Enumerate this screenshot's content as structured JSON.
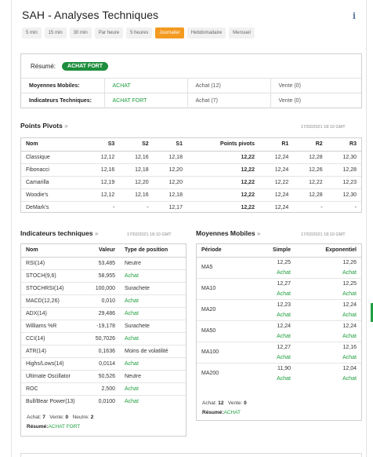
{
  "header": {
    "title": "SAH - Analyses Techniques",
    "info_icon": "info-icon"
  },
  "timeframes": [
    "5 min",
    "15 min",
    "30 min",
    "Par heure",
    "5 heures",
    "Journalier",
    "Hebdomadaire",
    "Mensuel"
  ],
  "active_timeframe": "Journalier",
  "summary": {
    "label": "Résumé:",
    "verdict": "ACHAT FORT",
    "rows": [
      {
        "name": "Moyennes Mobiles:",
        "signal": "ACHAT",
        "buy": "Achat (12)",
        "sell": "Vente (0)"
      },
      {
        "name": "Indicateurs Techniques:",
        "signal": "ACHAT FORT",
        "buy": "Achat (7)",
        "sell": "Vente (0)"
      }
    ]
  },
  "pivots": {
    "title": "Points Pivots",
    "chevron": "»",
    "date": "17/02/2021 18:10 GMT",
    "columns": [
      "Nom",
      "S3",
      "S2",
      "S1",
      "Points pivots",
      "R1",
      "R2",
      "R3"
    ],
    "rows": [
      [
        "Classique",
        "12,12",
        "12,16",
        "12,18",
        "12,22",
        "12,24",
        "12,28",
        "12,30"
      ],
      [
        "Fibonacci",
        "12,16",
        "12,18",
        "12,20",
        "12,22",
        "12,24",
        "12,26",
        "12,28"
      ],
      [
        "Camarilla",
        "12,19",
        "12,20",
        "12,20",
        "12,22",
        "12,22",
        "12,22",
        "12,23"
      ],
      [
        "Woodie's",
        "12,12",
        "12,16",
        "12,18",
        "12,22",
        "12,24",
        "12,28",
        "12,30"
      ],
      [
        "DeMark's",
        "-",
        "-",
        "12,17",
        "12,22",
        "12,24",
        "-",
        "-"
      ]
    ]
  },
  "indicators": {
    "title": "Indicateurs techniques",
    "chevron": "»",
    "date": "17/02/2021 18:10 GMT",
    "columns": [
      "Nom",
      "Valeur",
      "Type de position"
    ],
    "rows": [
      {
        "name": "RSI(14)",
        "value": "53,485",
        "action": "Neutre",
        "color": "#333333"
      },
      {
        "name": "STOCH(9,6)",
        "value": "58,955",
        "action": "Achat",
        "color": "#1e9e3e"
      },
      {
        "name": "STOCHRSI(14)",
        "value": "100,000",
        "action": "Surachete",
        "color": "#333333"
      },
      {
        "name": "MACD(12,26)",
        "value": "0,010",
        "action": "Achat",
        "color": "#1e9e3e"
      },
      {
        "name": "ADX(14)",
        "value": "29,486",
        "action": "Achat",
        "color": "#1e9e3e"
      },
      {
        "name": "Williams %R",
        "value": "-19,178",
        "action": "Surachete",
        "color": "#333333"
      },
      {
        "name": "CCI(14)",
        "value": "50,7026",
        "action": "Achat",
        "color": "#1e9e3e"
      },
      {
        "name": "ATR(14)",
        "value": "0,1636",
        "action": "Moins de volatilité",
        "color": "#333333"
      },
      {
        "name": "Highs/Lows(14)",
        "value": "0,0114",
        "action": "Achat",
        "color": "#1e9e3e"
      },
      {
        "name": "Ultimate Oscillator",
        "value": "50,526",
        "action": "Neutre",
        "color": "#333333"
      },
      {
        "name": "ROC",
        "value": "2,500",
        "action": "Achat",
        "color": "#1e9e3e"
      },
      {
        "name": "Bull/Bear Power(13)",
        "value": "0,0100",
        "action": "Achat",
        "color": "#1e9e3e"
      }
    ],
    "footer": {
      "buy_label": "Achat:",
      "buy": "7",
      "sell_label": "Vente:",
      "sell": "0",
      "neutral_label": "Neutre:",
      "neutral": "2",
      "summary_label": "Résumé:",
      "summary": "ACHAT FORT"
    }
  },
  "moving_averages": {
    "title": "Moyennes Mobiles",
    "chevron": "»",
    "date": "17/02/2021 18:10 GMT",
    "columns": [
      "Période",
      "Simple",
      "Exponentiel"
    ],
    "rows": [
      {
        "period": "MA5",
        "simple": "12,25",
        "simple_action": "Achat",
        "exp": "12,26",
        "exp_action": "Achat"
      },
      {
        "period": "MA10",
        "simple": "12,27",
        "simple_action": "Achat",
        "exp": "12,25",
        "exp_action": "Achat"
      },
      {
        "period": "MA20",
        "simple": "12,23",
        "simple_action": "Achat",
        "exp": "12,24",
        "exp_action": "Achat"
      },
      {
        "period": "MA50",
        "simple": "12,24",
        "simple_action": "Achat",
        "exp": "12,24",
        "exp_action": "Achat"
      },
      {
        "period": "MA100",
        "simple": "12,27",
        "simple_action": "Achat",
        "exp": "12,16",
        "exp_action": "Achat"
      },
      {
        "period": "MA200",
        "simple": "11,90",
        "simple_action": "Achat",
        "exp": "12,04",
        "exp_action": "Achat"
      }
    ],
    "footer": {
      "buy_label": "Achat:",
      "buy": "12",
      "sell_label": "Vente:",
      "sell": "0",
      "summary_label": "Résumé:",
      "summary": "ACHAT"
    }
  },
  "colors": {
    "accent": "#f39a20",
    "buy": "#1e9e3e",
    "border": "#cfcfcf"
  }
}
